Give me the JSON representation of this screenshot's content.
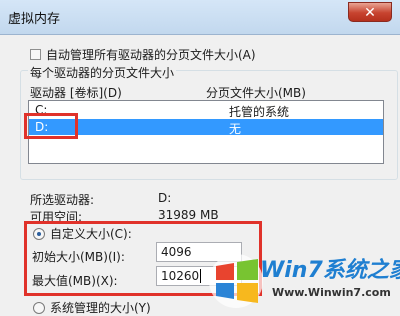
{
  "window": {
    "title": "虚拟内存",
    "close_glyph": "✕"
  },
  "auto_manage": {
    "label": "自动管理所有驱动器的分页文件大小(A)",
    "checked": false
  },
  "group": {
    "legend": "每个驱动器的分页文件大小",
    "col_drive": "驱动器 [卷标](D)",
    "col_pagefile": "分页文件大小(MB)"
  },
  "drives": [
    {
      "drive": "C:",
      "size": "托管的系统",
      "selected": false
    },
    {
      "drive": "D:",
      "size": "无",
      "selected": true
    }
  ],
  "info": {
    "selected_label": "所选驱动器:",
    "selected_value": "D:",
    "space_label": "可用空间:",
    "space_value": "31989 MB"
  },
  "custom": {
    "label": "自定义大小(C):",
    "selected": true,
    "initial_label": "初始大小(MB)(I):",
    "initial_value": "4096",
    "max_label": "最大值(MB)(X):",
    "max_value": "10260"
  },
  "system_managed": {
    "label": "系统管理的大小(Y)",
    "selected": false
  },
  "watermark": {
    "brand": "Win7系统之家",
    "url": "Www.Winwin7.com"
  },
  "colors": {
    "highlight": "#e0322a",
    "selection": "#3399ff"
  }
}
